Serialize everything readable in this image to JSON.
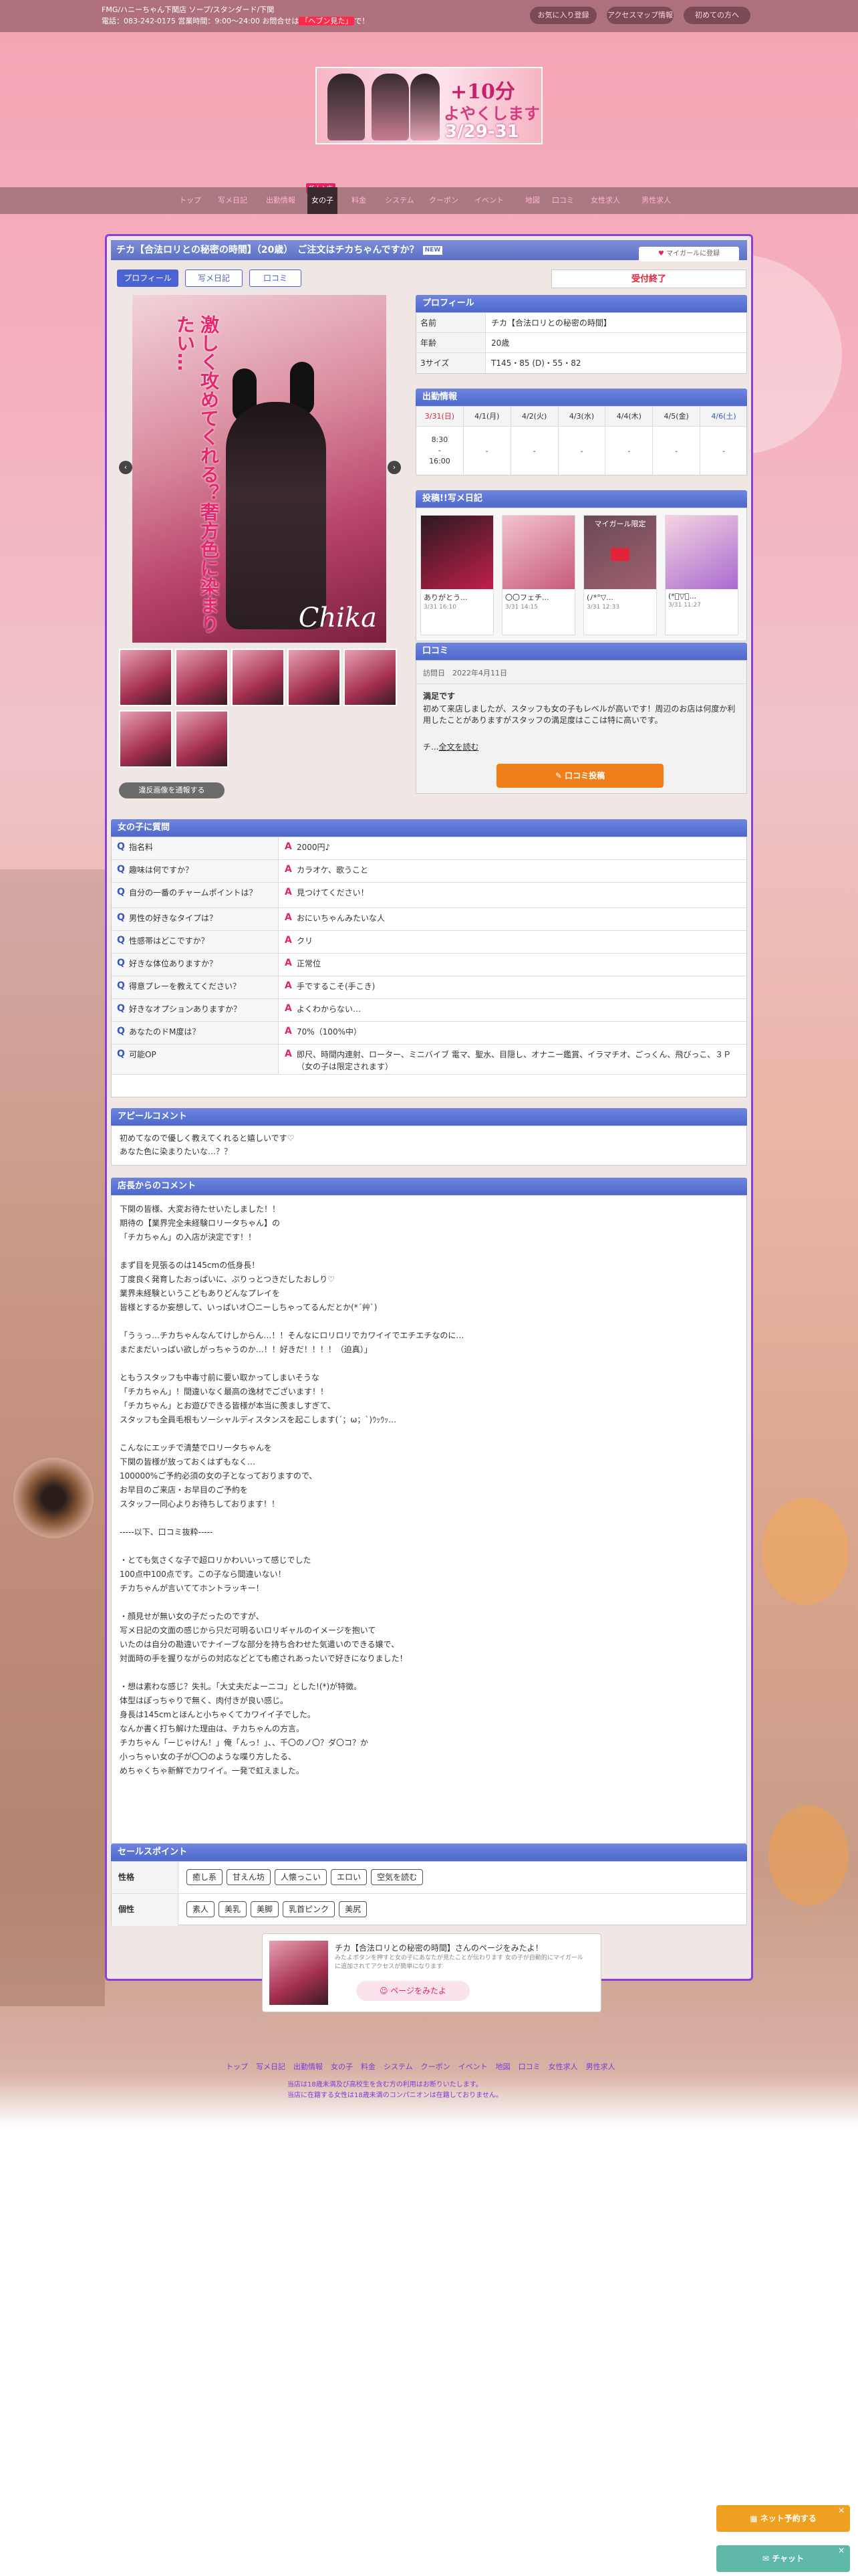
{
  "topbar": {
    "line1": "FMG/ハニーちゃん下関店 ソープ/スタンダード/下関",
    "line2_prefix": "電話：083-242-0175 営業時間：9:00〜24:00 お問合せは",
    "line2_highlight": "「ヘブン見た」",
    "line2_suffix": "で！",
    "buttons": [
      "お気に入り登録",
      "アクセスマップ情報",
      "初めての方へ"
    ]
  },
  "banner": {
    "line1": "+10分",
    "line2": "よやくします",
    "line3": "3/29-31"
  },
  "nav": {
    "new_badge": "新人入店",
    "items": [
      "トップ",
      "写メ日記",
      "出勤情報",
      "女の子",
      "料金",
      "システム",
      "クーポン",
      "イベント",
      "地図",
      "口コミ",
      "女性求人",
      "男性求人"
    ],
    "active_index": 3
  },
  "title": {
    "text": "チカ【合法ロリとの秘密の時間】（20歳）　ご注文はチカちゃんですか？",
    "new_label": "NEW",
    "mygirl_label": "マイガールに登録"
  },
  "tabs": [
    "プロフィール",
    "写メ日記",
    "口コミ"
  ],
  "status": "受付終了",
  "photo": {
    "overlay_text": "激しく攻めてくれる？奢方色に染まりたい…",
    "signature": "Chika",
    "hires_button": "違反画像を通報する",
    "prev": "‹",
    "next": "›"
  },
  "profile": {
    "heading": "プロフィール",
    "rows": [
      {
        "label": "名前",
        "value": "チカ【合法ロリとの秘密の時間】"
      },
      {
        "label": "年齢",
        "value": "20歳"
      },
      {
        "label": "3サイズ",
        "value": "T145・85 (D)・55・82"
      }
    ]
  },
  "schedule": {
    "heading": "出勤情報",
    "days": [
      "3/31(日)",
      "4/1(月)",
      "4/2(火)",
      "4/3(水)",
      "4/4(木)",
      "4/5(金)",
      "4/6(土)"
    ],
    "day_colors": [
      "#e0243a",
      "#333333",
      "#333333",
      "#333333",
      "#333333",
      "#333333",
      "#3a55c8"
    ],
    "first_time": "8:30\n-\n16:00",
    "other": "-"
  },
  "diary": {
    "heading": "投稿!!写メ日記",
    "mygirl_limited": "マイガール限定",
    "posts": [
      {
        "title": "ありがとう...",
        "date": "3/31 16:10"
      },
      {
        "title": "〇〇フェチ...",
        "date": "3/31 14:15"
      },
      {
        "title": "(ﾉ*°▽...",
        "date": "3/31 12:33"
      },
      {
        "title": "(*ﾟ▽ﾟ...",
        "date": "3/31 11:27"
      }
    ]
  },
  "review": {
    "heading": "口コミ",
    "visit_label": "訪問日",
    "visit_date": "2022年4月11日",
    "title": "満足です",
    "body": "初めて来店しましたが、スタッフも女の子もレベルが高いです！周辺のお店は何度か利用したことがありますがスタッフの満足度はここは特に高いです。",
    "more_prefix": "チ...",
    "more_link": "全文を読む",
    "post_button": "✎ 口コミ投稿"
  },
  "qa": {
    "heading": "女の子に質問",
    "items": [
      {
        "q": "指名料",
        "a": "2000円♪"
      },
      {
        "q": "趣味は何ですか？",
        "a": "カラオケ、歌うこと"
      },
      {
        "q": "自分の一番のチャームポイントは？",
        "a": "見つけてください！"
      },
      {
        "q": "男性の好きなタイプは？",
        "a": "おにいちゃんみたいな人"
      },
      {
        "q": "性感帯はどこですか？",
        "a": "クリ"
      },
      {
        "q": "好きな体位ありますか？",
        "a": "正常位"
      },
      {
        "q": "得意プレーを教えてください？",
        "a": "手でするこそ(手こき)"
      },
      {
        "q": "好きなオプションありますか？",
        "a": "よくわからない…"
      },
      {
        "q": "あなたのドM度は？",
        "a": "70%（100%中）"
      },
      {
        "q": "可能OP",
        "a": "即尺、時間内連射、ローター、ミニバイブ 電マ、聖水、目隠し、オナニー鑑賞、イラマチオ、ごっくん、飛びっこ、３Ｐ（女の子は限定されます）"
      }
    ]
  },
  "appeal": {
    "heading": "アピールコメント",
    "lines": [
      "初めてなので優しく教えてくれると嬉しいです♡",
      "あなた色に染まりたいな…？？"
    ]
  },
  "shop_comment": {
    "heading": "店長からのコメント",
    "lines": [
      "下関の皆様、大変お待たせいたしました！！",
      "期待の【業界完全未経験ロリータちゃん】の",
      "「チカちゃん」の入店が決定です！！",
      "",
      "まず目を見張るのは145cmの低身長！",
      "丁度良く発育したおっぱいに、ぷりっとつきだしたおしり♡",
      "業界未経験というこどもありどんなプレイを",
      "皆様とするか妄想して、いっぱいオ〇ニーしちゃってるんだとか(*´艸`)",
      "",
      "「うぅっ…チカちゃんなんてけしからん…！！そんなにロリロリでカワイイでエチエチなのに…",
      "まだまだいっぱい欲しがっちゃうのか…！！好きだ！！！！（迫真）」",
      "",
      "ともうスタッフも中毒寸前に要い取かってしまいそうな",
      "「チカちゃん」！間違いなく最高の逸材でございます！！",
      "「チカちゃん」とお遊びできる皆様が本当に羨ましすぎて、",
      "スタッフも全員毛根もソーシャルディスタンスを起こします(´；ω；`)ｳｯｳｯ…",
      "",
      "こんなにエッチで清楚でロリータちゃんを",
      "下関の皆様が放っておくはずもなく…",
      "100000%ご予約必須の女の子となっておりますので、",
      "お早目のご来店・お早目のご予約を",
      "スタッフ一同心よりお待ちしております！！",
      "",
      "-----以下、口コミ抜粋-----",
      "",
      "・とても気さくな子で超ロリかわいいって感じでした",
      "100点中100点です。この子なら間違いない！",
      "チカちゃんが言いててホントラッキー！",
      "",
      "・顔見せが無い女の子だったのですが、",
      "写メ日記の文面の感じから只だ可明るいロリギャルのイメージを抱いて",
      "いたのは自分の勘違いでナイーブな部分を持ち合わせた気遣いのできる嬢で、",
      "対面時の手を握りながらの対応などとても癒されあったいで好きになりました！",
      "",
      "・想は素わな感じ？失礼。「大丈夫だよーニコ」とした!(*)が特徴。",
      "体型はぽっちゃりで無く、肉付きが良い感じ。",
      "身長は145cmとほんと小ちゃくてカワイイ子でした。",
      "なんか書く打ち解けた理由は、チカちゃんの方言。",
      "チカちゃん「ーじゃけん！」俺「んっ！」、、千〇のノ〇？ダ〇コ？か",
      "小っちゃい女の子が〇〇のような喋り方したる、",
      "めちゃくちゃ新鮮でカワイイ。一発で虹えました。"
    ]
  },
  "sales": {
    "heading": "セールスポイント",
    "rows": [
      {
        "label": "性格",
        "chips": [
          "癒し系",
          "甘えん坊",
          "人懐っこい",
          "エロい",
          "空気を読む"
        ]
      },
      {
        "label": "個性",
        "chips": [
          "素人",
          "美乳",
          "美脚",
          "乳首ピンク",
          "美尻"
        ]
      }
    ]
  },
  "share": {
    "title": "チカ【合法ロリとの秘密の時間】さんのページをみたよ！",
    "desc": "みたよボタンを押すと女の子にあなたが見たことが伝わります 女の子が自動的にマイガールに追加されてアクセスが簡単になります",
    "button": "☺ ページをみたよ"
  },
  "footer": {
    "nav": [
      "トップ",
      "写メ日記",
      "出勤情報",
      "女の子",
      "料金",
      "システム",
      "クーポン",
      "イベント",
      "地図",
      "口コミ",
      "女性求人",
      "男性求人"
    ],
    "text1": "当店は18歳未満及び高校生を含む方の利用はお断りいたします。",
    "text2": "当店に在籍する女性は18歳未満のコンパニオンは在籍しておりません。"
  },
  "floating": {
    "reserve": "ネット予約する",
    "chat": "チャット"
  }
}
